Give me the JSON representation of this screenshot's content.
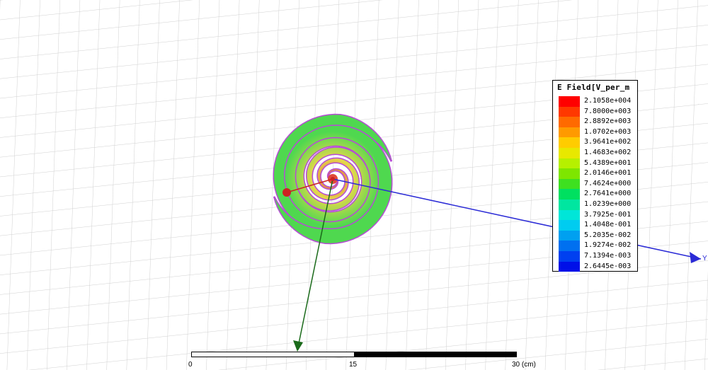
{
  "legend": {
    "title": "E Field[V_per_m",
    "levels": [
      {
        "value": "2.1058e+004",
        "color": "#ff0000"
      },
      {
        "value": "7.8000e+003",
        "color": "#ff3800"
      },
      {
        "value": "2.8892e+003",
        "color": "#ff6a00"
      },
      {
        "value": "1.0702e+003",
        "color": "#ff9a00"
      },
      {
        "value": "3.9641e+002",
        "color": "#ffcc00"
      },
      {
        "value": "1.4683e+002",
        "color": "#e8e800"
      },
      {
        "value": "5.4389e+001",
        "color": "#b6f000"
      },
      {
        "value": "2.0146e+001",
        "color": "#7ee600"
      },
      {
        "value": "7.4624e+000",
        "color": "#3ee020"
      },
      {
        "value": "2.7641e+000",
        "color": "#00e060"
      },
      {
        "value": "1.0239e+000",
        "color": "#00e6a0"
      },
      {
        "value": "3.7925e-001",
        "color": "#00e6d8"
      },
      {
        "value": "1.4048e-001",
        "color": "#00ccf0"
      },
      {
        "value": "5.2035e-002",
        "color": "#00a0f0"
      },
      {
        "value": "1.9274e-002",
        "color": "#0070f0"
      },
      {
        "value": "7.1394e-003",
        "color": "#0040f0"
      },
      {
        "value": "2.6445e-003",
        "color": "#0010e8"
      }
    ]
  },
  "axes": {
    "y_label": "Y",
    "x_color": "#2b2bd6",
    "y_color": "#1a6a1a",
    "z_color": "#cc2222"
  },
  "scale": {
    "label_start": "0",
    "label_mid": "15",
    "label_end": "30 (cm)"
  },
  "spiral_colors": {
    "outer": "#4fd84f",
    "edge": "#b74ad6",
    "inner": "#e4d84a",
    "core": "#e04a3a"
  }
}
